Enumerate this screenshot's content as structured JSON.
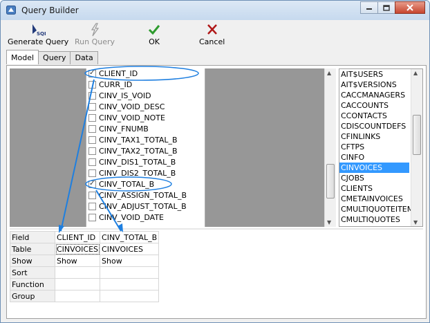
{
  "window": {
    "title": "Query Builder"
  },
  "toolbar": {
    "generate": "Generate Query",
    "run": "Run Query",
    "ok": "OK",
    "cancel": "Cancel"
  },
  "tabs": [
    "Model",
    "Query",
    "Data"
  ],
  "fields": [
    {
      "name": "CLIENT_ID",
      "checked": true
    },
    {
      "name": "CURR_ID",
      "checked": false
    },
    {
      "name": "CINV_IS_VOID",
      "checked": false
    },
    {
      "name": "CINV_VOID_DESC",
      "checked": false
    },
    {
      "name": "CINV_VOID_NOTE",
      "checked": false
    },
    {
      "name": "CINV_FNUMB",
      "checked": false
    },
    {
      "name": "CINV_TAX1_TOTAL_B",
      "checked": false
    },
    {
      "name": "CINV_TAX2_TOTAL_B",
      "checked": false
    },
    {
      "name": "CINV_DIS1_TOTAL_B",
      "checked": false
    },
    {
      "name": "CINV_DIS2_TOTAL_B",
      "checked": false
    },
    {
      "name": "CINV_TOTAL_B",
      "checked": true
    },
    {
      "name": "CINV_ASSIGN_TOTAL_B",
      "checked": false
    },
    {
      "name": "CINV_ADJUST_TOTAL_B",
      "checked": false
    },
    {
      "name": "CINV_VOID_DATE",
      "checked": false
    }
  ],
  "tables": [
    "AIT$USERS",
    "AIT$VERSIONS",
    "CACCMANAGERS",
    "CACCOUNTS",
    "CCONTACTS",
    "CDISCOUNTDEFS",
    "CFINLINKS",
    "CFTPS",
    "CINFO",
    "CINVOICES",
    "CJOBS",
    "CLIENTS",
    "CMETAINVOICES",
    "CMULTIQUOTEITEMS",
    "CMULTIQUOTES"
  ],
  "selected_table": "CINVOICES",
  "grid": {
    "row_headers": [
      "Field",
      "Table",
      "Show",
      "Sort",
      "Function",
      "Group"
    ],
    "columns": [
      {
        "Field": "CLIENT_ID",
        "Table": "CINVOICES",
        "Show": "Show",
        "Sort": "",
        "Function": "",
        "Group": ""
      },
      {
        "Field": "CINV_TOTAL_B",
        "Table": "CINVOICES",
        "Show": "Show",
        "Sort": "",
        "Function": "",
        "Group": ""
      }
    ]
  },
  "colors": {
    "selection": "#3399ff",
    "annotation": "#1e7fe0",
    "grey_area": "#979797"
  }
}
